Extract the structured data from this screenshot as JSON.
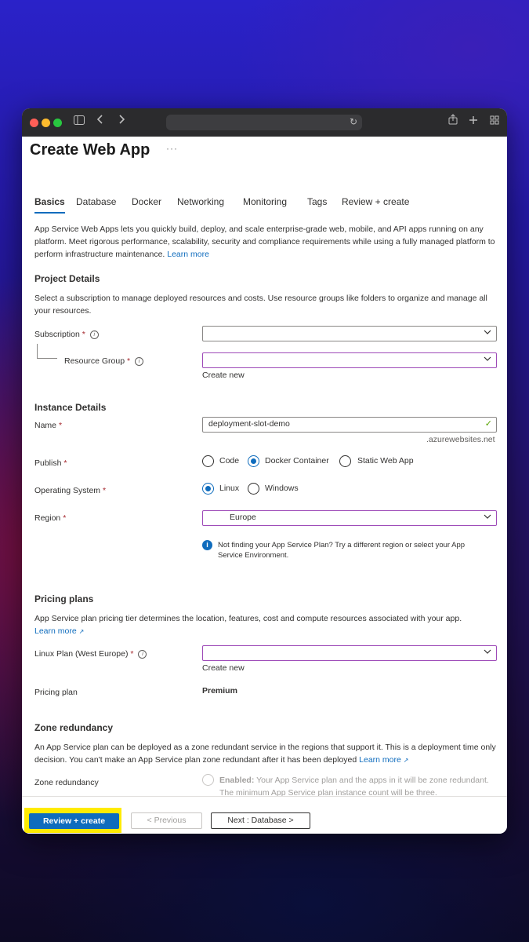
{
  "page": {
    "title": "Create Web App",
    "title_more": "···",
    "tabs": [
      {
        "label": "Basics",
        "active": true
      },
      {
        "label": "Database"
      },
      {
        "label": "Docker"
      },
      {
        "label": "Networking"
      },
      {
        "label": "Monitoring"
      },
      {
        "label": "Tags"
      },
      {
        "label": "Review + create"
      }
    ],
    "intro": "App Service Web Apps lets you quickly build, deploy, and scale enterprise-grade web, mobile, and API apps running on any platform. Meet rigorous performance, scalability, security and compliance requirements while using a fully managed platform to perform infrastructure maintenance.",
    "learn_more": "Learn more"
  },
  "project": {
    "heading": "Project Details",
    "description": "Select a subscription to manage deployed resources and costs. Use resource groups like folders to organize and manage all your resources.",
    "subscription_label": "Subscription",
    "resource_group_label": "Resource Group",
    "create_new": "Create new"
  },
  "instance": {
    "heading": "Instance Details",
    "name_label": "Name",
    "name_value": "deployment-slot-demo",
    "name_suffix": ".azurewebsites.net",
    "publish_label": "Publish",
    "publish_options": [
      "Code",
      "Docker Container",
      "Static Web App"
    ],
    "publish_selected": "Docker Container",
    "os_label": "Operating System",
    "os_options": [
      "Linux",
      "Windows"
    ],
    "os_selected": "Linux",
    "region_label": "Region",
    "region_value": "Europe",
    "region_info": "Not finding your App Service Plan? Try a different region or select your App Service Environment."
  },
  "pricing": {
    "heading": "Pricing plans",
    "description": "App Service plan pricing tier determines the location, features, cost and compute resources associated with your app.",
    "learn_more": "Learn more",
    "plan_label": "Linux Plan (West Europe)",
    "create_new": "Create new",
    "pricing_plan_label": "Pricing plan",
    "pricing_plan_value": "Premium"
  },
  "zone": {
    "heading": "Zone redundancy",
    "description": "An App Service plan can be deployed as a zone redundant service in the regions that support it. This is a deployment time only decision. You can't make an App Service plan zone redundant after it has been deployed",
    "learn_more": "Learn more",
    "label": "Zone redundancy",
    "enabled_title": "Enabled:",
    "enabled_text": "Your App Service plan and the apps in it will be zone redundant. The minimum App Service plan instance count will be three."
  },
  "footer": {
    "review_create": "Review + create",
    "previous": "< Previous",
    "next": "Next : Database >"
  },
  "colors": {
    "accent": "#0f6cbd",
    "highlight": "#ffeb00",
    "required": "#a4262c"
  }
}
